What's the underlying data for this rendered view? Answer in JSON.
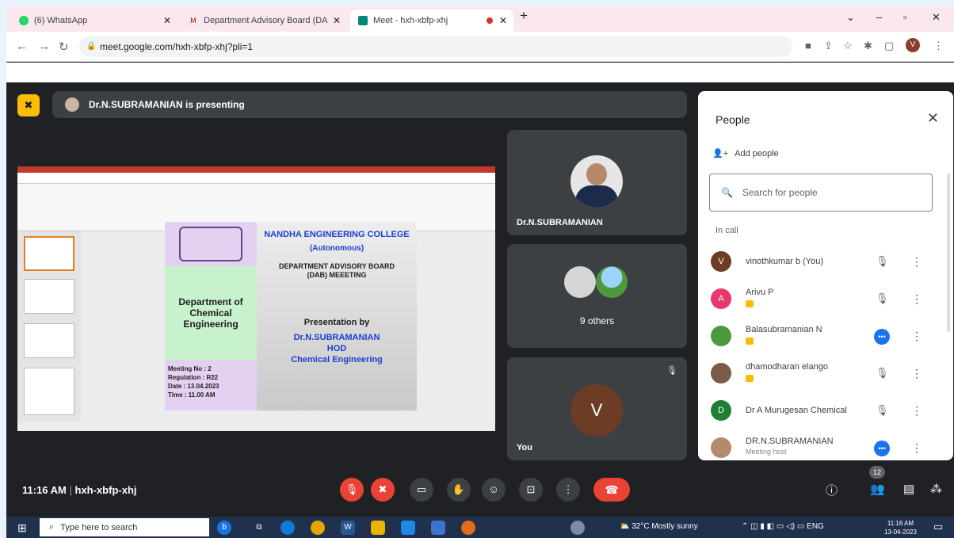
{
  "browser": {
    "tabs": [
      {
        "label": "(6) WhatsApp",
        "active": false
      },
      {
        "label": "Department Advisory Board (DA",
        "active": false
      },
      {
        "label": "Meet - hxh-xbfp-xhj",
        "active": true
      }
    ],
    "new_tab": "+",
    "url": "meet.google.com/hxh-xbfp-xhj?pli=1",
    "profile_initial": "V"
  },
  "meet": {
    "presenting_text": "Dr.N.SUBRAMANIAN is presenting",
    "tiles": [
      {
        "name": "Dr.N.SUBRAMANIAN"
      },
      {
        "name": "9 others"
      },
      {
        "name": "You",
        "initial": "V"
      }
    ],
    "meeting_time": "11:16 AM",
    "meeting_code": "hxh-xbfp-xhj",
    "participant_count": "12"
  },
  "slide": {
    "college": "NANDHA ENGINEERING COLLEGE",
    "autonomous": "(Autonomous)",
    "dab_title_1": "DEPARTMENT ADVISORY BOARD",
    "dab_title_2": "(DAB) MEEETING",
    "department": "Department of Chemical Engineering",
    "meeting_no": "Meeting No  :  2",
    "regulation": "Regulation  :  R22",
    "date": "Date          :  13.04.2023",
    "time": "Time          :  11.00 AM",
    "presentation_by": "Presentation by",
    "presenter": "Dr.N.SUBRAMANIAN",
    "hod": "HOD",
    "presenter_dept": "Chemical Engineering"
  },
  "people": {
    "title": "People",
    "add_people": "Add people",
    "search_placeholder": "Search for people",
    "in_call": "In call",
    "list": [
      {
        "initial": "V",
        "name": "vinothkumar b (You)",
        "color": "#6d3c26"
      },
      {
        "initial": "A",
        "name": "Arivu P",
        "color": "#e8386c"
      },
      {
        "initial": "",
        "name": "Balasubramanian N",
        "color": "#4e9a3b"
      },
      {
        "initial": "",
        "name": "dhamodharan elango",
        "color": "#7a5a48"
      },
      {
        "initial": "D",
        "name": "Dr A Murugesan Chemical",
        "color": "#1e7e34"
      },
      {
        "initial": "",
        "name": "DR.N.SUBRAMANIAN",
        "sub": "Meeting host",
        "color": "#b58a6a"
      }
    ]
  },
  "taskbar": {
    "search_placeholder": "Type here to search",
    "weather": "32°C  Mostly sunny",
    "lang": "ENG",
    "time": "11:16 AM",
    "date": "13-04-2023"
  }
}
